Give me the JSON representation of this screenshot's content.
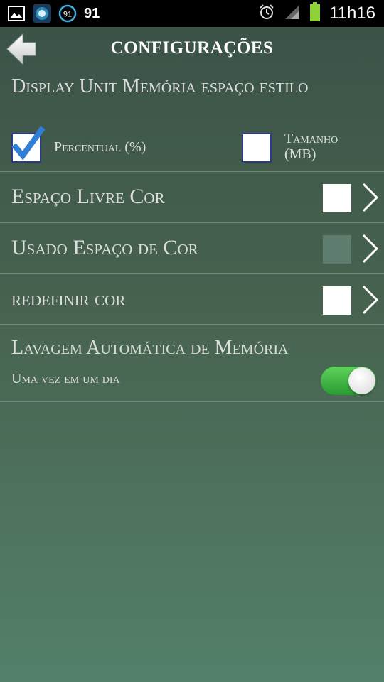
{
  "status_bar": {
    "notification_badge": "91",
    "notification_count": "91",
    "time": "11h16",
    "icons": [
      "image-icon",
      "app-icon",
      "badge-icon",
      "alarm-icon",
      "signal-icon",
      "battery-icon"
    ]
  },
  "header": {
    "title": "CONFIGURAÇÕES"
  },
  "display_unit": {
    "heading": "Display Unit Memória espaço estilo",
    "options": [
      {
        "label": "Percentual (%)",
        "checked": true
      },
      {
        "label": "Tamanho (MB)",
        "checked": false
      }
    ]
  },
  "rows": [
    {
      "label": "Espaço Livre Cor",
      "swatch_color": "#ffffff"
    },
    {
      "label": "Usado Espaço de Cor",
      "swatch_color": "#5e7d6e"
    },
    {
      "label": "redefinir cor",
      "swatch_color": "#ffffff"
    }
  ],
  "auto_clean": {
    "heading": "Lavagem Automática de Memória",
    "subtitle": "Uma vez em um dia",
    "enabled": true
  },
  "colors": {
    "accent_check": "#2f7fd6",
    "toggle_on": "#3fb541"
  }
}
